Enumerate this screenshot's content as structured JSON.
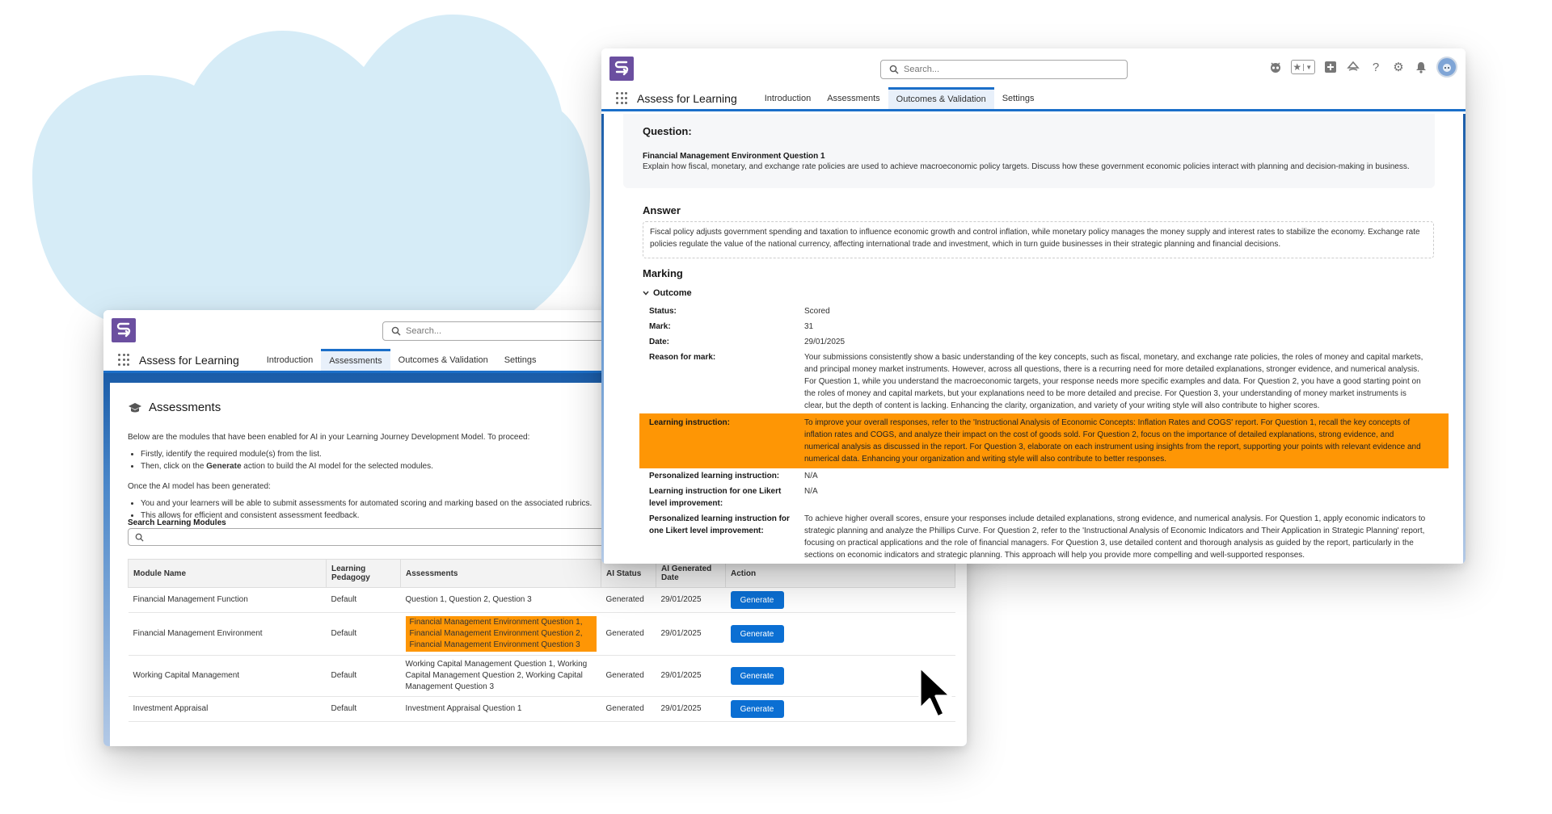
{
  "colors": {
    "brand_purple": "#6b4fa0",
    "accent_blue": "#1b6fc9",
    "highlight_orange": "#fe9605",
    "cloud": "#d6ecf7",
    "button_blue": "#0b6fd3"
  },
  "app": {
    "name": "Assess for Learning",
    "search_placeholder": "Search...",
    "tabs": [
      "Introduction",
      "Assessments",
      "Outcomes & Validation",
      "Settings"
    ],
    "header_icons": [
      "agent-icon",
      "favorites-star-icon",
      "favorites-dropdown-icon",
      "add-icon",
      "trailhead-icon",
      "help-icon",
      "settings-gear-icon",
      "notifications-bell-icon",
      "user-avatar"
    ]
  },
  "front_window": {
    "active_tab": "Outcomes & Validation",
    "question": {
      "heading": "Question:",
      "title": "Financial Management Environment Question 1",
      "text": "Explain how fiscal, monetary, and exchange rate policies are used to achieve macroeconomic policy targets. Discuss how these government economic policies interact with planning and decision-making in business."
    },
    "answer": {
      "heading": "Answer",
      "text": "Fiscal policy adjusts government spending and taxation to influence economic growth and control inflation, while monetary policy manages the money supply and interest rates to stabilize the economy. Exchange rate policies regulate the value of the national currency, affecting international trade and investment, which in turn guide businesses in their strategic planning and financial decisions."
    },
    "marking": {
      "heading": "Marking",
      "outcome_label": "Outcome",
      "fields": [
        {
          "label": "Status:",
          "value": "Scored"
        },
        {
          "label": "Mark:",
          "value": "31"
        },
        {
          "label": "Date:",
          "value": "29/01/2025"
        },
        {
          "label": "Reason for mark:",
          "value": "Your submissions consistently show a basic understanding of the key concepts, such as fiscal, monetary, and exchange rate policies, the roles of money and capital markets, and principal money market instruments. However, across all questions, there is a recurring need for more detailed explanations, stronger evidence, and numerical analysis. For Question 1, while you understand the macroeconomic targets, your response needs more specific examples and data. For Question 2, you have a good starting point on the roles of money and capital markets, but your explanations need to be more detailed and precise. For Question 3, your understanding of money market instruments is clear, but the depth of content is lacking. Enhancing the clarity, organization, and variety of your writing style will also contribute to higher scores."
        },
        {
          "label": "Learning instruction:",
          "value": "To improve your overall responses, refer to the 'Instructional Analysis of Economic Concepts: Inflation Rates and COGS' report. For Question 1, recall the key concepts of inflation rates and COGS, and analyze their impact on the cost of goods sold. For Question 2, focus on the importance of detailed explanations, strong evidence, and numerical analysis as discussed in the report. For Question 3, elaborate on each instrument using insights from the report, supporting your points with relevant evidence and numerical data. Enhancing your organization and writing style will also contribute to better responses.",
          "highlighted": true
        },
        {
          "label": "Personalized learning instruction:",
          "value": "N/A"
        },
        {
          "label": "Learning instruction for one Likert level improvement:",
          "value": "N/A"
        },
        {
          "label": "Personalized learning instruction for one Likert level improvement:",
          "value": "To achieve higher overall scores, ensure your responses include detailed explanations, strong evidence, and numerical analysis. For Question 1, apply economic indicators to strategic planning and analyze the Phillips Curve. For Question 2, refer to the 'Instructional Analysis of Economic Indicators and Their Application in Strategic Planning' report, focusing on practical applications and the role of financial managers. For Question 3, use detailed content and thorough analysis as guided by the report, particularly in the sections on economic indicators and strategic planning. This approach will help you provide more compelling and well-supported responses."
        }
      ]
    }
  },
  "back_window": {
    "active_tab": "Assessments",
    "title": "Assessments",
    "intro": "Below are the modules that have been enabled for AI in your Learning Journey Development Model. To proceed:",
    "steps": [
      "Firstly, identify the required module(s) from the list.",
      "Then, click on the ",
      "Generate",
      " action to build the AI model for the selected modules."
    ],
    "after_heading": "Once the AI model has been generated:",
    "after_points": [
      "You and your learners will be able to submit assessments for automated scoring and marking based on the associated rubrics.",
      "This allows for efficient and consistent assessment feedback."
    ],
    "search_label": "Search Learning Modules",
    "search_value": "",
    "table": {
      "headers": [
        "Module Name",
        "Learning Pedagogy",
        "Assessments",
        "AI Status",
        "AI Generated Date",
        "Action"
      ],
      "rows": [
        {
          "module": "Financial Management Function",
          "pedagogy": "Default",
          "assessments": "Question 1, Question 2, Question 3",
          "status": "Generated",
          "date": "29/01/2025",
          "action": "Generate"
        },
        {
          "module": "Financial Management Environment",
          "pedagogy": "Default",
          "assessments": "Financial Management Environment Question 1, Financial Management Environment Question 2, Financial Management Environment Question 3",
          "status": "Generated",
          "date": "29/01/2025",
          "action": "Generate",
          "highlighted": true
        },
        {
          "module": "Working Capital Management",
          "pedagogy": "Default",
          "assessments": "Working Capital Management Question 1, Working Capital Management Question 2, Working Capital Management Question 3",
          "status": "Generated",
          "date": "29/01/2025",
          "action": "Generate"
        },
        {
          "module": "Investment Appraisal",
          "pedagogy": "Default",
          "assessments": "Investment Appraisal Question 1",
          "status": "Generated",
          "date": "29/01/2025",
          "action": "Generate"
        }
      ]
    }
  }
}
